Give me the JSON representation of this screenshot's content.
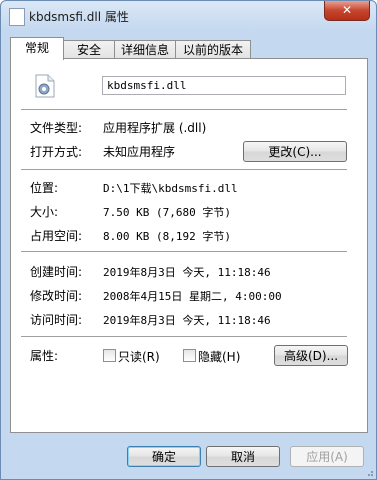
{
  "window": {
    "title": "kbdsmsfi.dll 属性",
    "close_label": "✕"
  },
  "tabs": [
    {
      "label": "常规",
      "active": true
    },
    {
      "label": "安全",
      "active": false
    },
    {
      "label": "详细信息",
      "active": false
    },
    {
      "label": "以前的版本",
      "active": false
    }
  ],
  "general": {
    "file_name": "kbdsmsfi.dll",
    "file_type_label": "文件类型:",
    "file_type_value": "应用程序扩展 (.dll)",
    "opens_with_label": "打开方式:",
    "opens_with_value": "未知应用程序",
    "change_button": "更改(C)...",
    "location_label": "位置:",
    "location_value": "D:\\1下载\\kbdsmsfi.dll",
    "size_label": "大小:",
    "size_value": "7.50 KB (7,680 字节)",
    "size_on_disk_label": "占用空间:",
    "size_on_disk_value": "8.00 KB (8,192 字节)",
    "created_label": "创建时间:",
    "created_value": "2019年8月3日 今天, 11:18:46",
    "modified_label": "修改时间:",
    "modified_value": "2008年4月15日 星期二, 4:00:00",
    "accessed_label": "访问时间:",
    "accessed_value": "2019年8月3日 今天, 11:18:46",
    "attributes_label": "属性:",
    "readonly_label": "只读(R)",
    "hidden_label": "隐藏(H)",
    "advanced_button": "高级(D)..."
  },
  "footer": {
    "ok": "确定",
    "cancel": "取消",
    "apply": "应用(A)"
  },
  "icons": {
    "file": "dll-file-gear-icon",
    "title": "dll-file-icon"
  }
}
